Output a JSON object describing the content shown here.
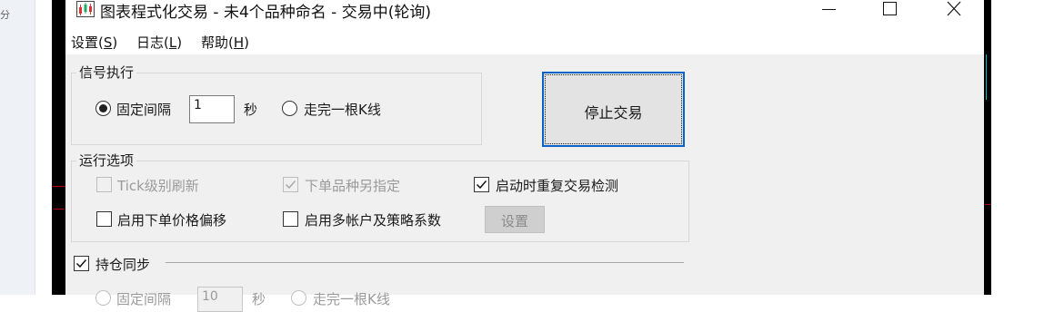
{
  "background": {
    "sidebar_text": "分"
  },
  "window": {
    "title": "图表程式化交易 - 未4个品种命名 - 交易中(轮询)",
    "menu": [
      {
        "label": "设置(",
        "accel": "S",
        "end": ")"
      },
      {
        "label": "日志(",
        "accel": "L",
        "end": ")"
      },
      {
        "label": "帮助(",
        "accel": "H",
        "end": ")"
      }
    ]
  },
  "signal_exec": {
    "title": "信号执行",
    "fixed_interval_label": "固定间隔",
    "interval_value": "1",
    "seconds_label": "秒",
    "kline_label": "走完一根K线",
    "selected": "fixed_interval"
  },
  "stop_button": {
    "label": "停止交易"
  },
  "run_options": {
    "title": "运行选项",
    "tick_refresh": {
      "label": "Tick级别刷新",
      "checked": false,
      "enabled": false
    },
    "order_symbol": {
      "label": "下单品种另指定",
      "checked": true,
      "enabled": false
    },
    "startup_check": {
      "label": "启动时重复交易检测",
      "checked": true,
      "enabled": true
    },
    "price_offset": {
      "label": "启用下单价格偏移",
      "checked": false,
      "enabled": true
    },
    "multi_account": {
      "label": "启用多帐户及策略系数",
      "checked": false,
      "enabled": true
    },
    "settings_button": "设置"
  },
  "position_sync": {
    "label": "持仓同步",
    "checked": true,
    "sub_fixed_label": "固定间隔",
    "sub_interval_value": "10",
    "sub_seconds_label": "秒",
    "sub_kline_label": "走完一根K线"
  }
}
